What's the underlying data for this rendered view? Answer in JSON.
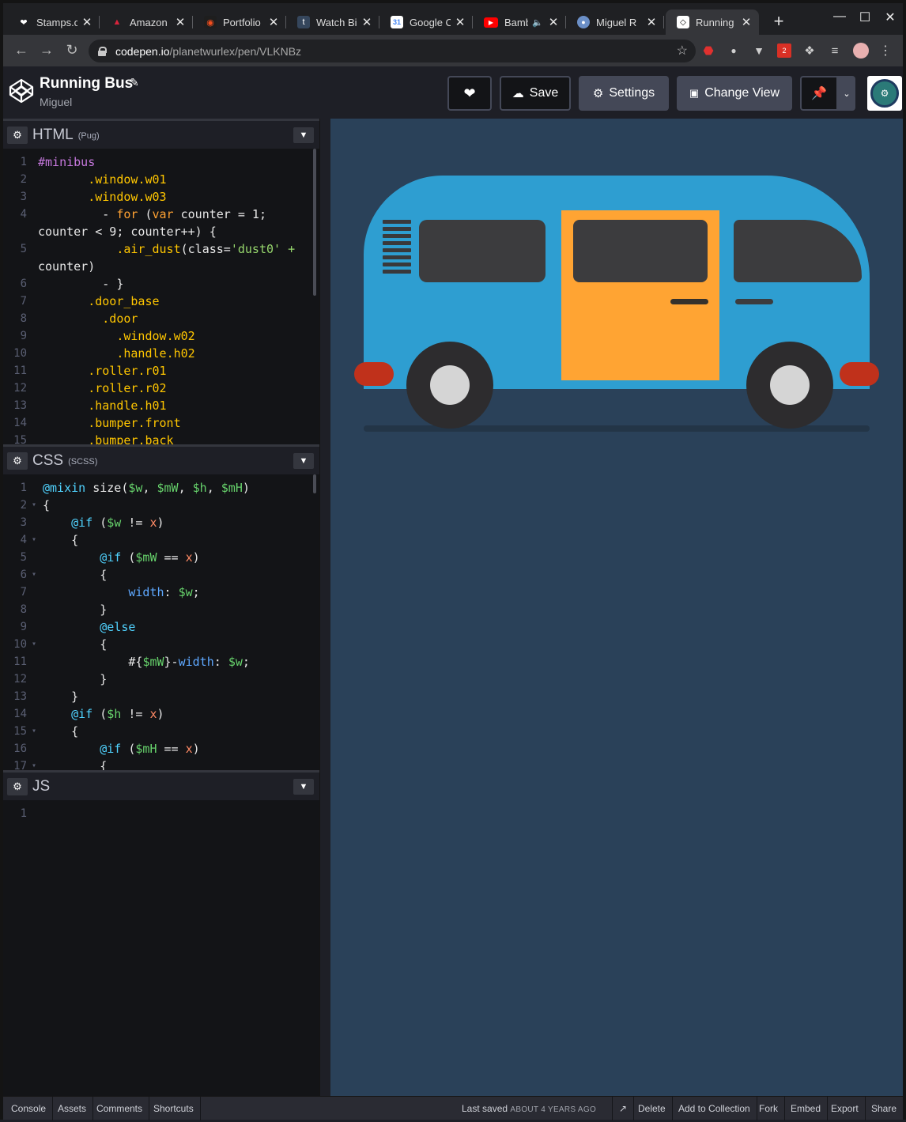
{
  "browser": {
    "tabs": [
      {
        "title": "Stamps.c",
        "icon": "heart-favicon",
        "color": "#ffffff"
      },
      {
        "title": "Amazon (",
        "icon": "bird-favicon",
        "color": "#d8243c"
      },
      {
        "title": "Portfolio",
        "icon": "figma-favicon",
        "color": "#f24e1e"
      },
      {
        "title": "Watch Bi",
        "icon": "tumblr-favicon",
        "color": "#35465c"
      },
      {
        "title": "Google C",
        "icon": "calendar-favicon",
        "color": "#4285f4"
      },
      {
        "title": "Bamb",
        "icon": "youtube-favicon",
        "color": "#ff0000"
      },
      {
        "title": "Miguel R",
        "icon": "avatar-favicon",
        "color": "#6b8fc7"
      },
      {
        "title": "Running",
        "icon": "codepen-favicon",
        "color": "#ffffff"
      }
    ],
    "url_host": "codepen.io",
    "url_path": "/planetwurlex/pen/VLKNBz",
    "extension_badge": "2"
  },
  "pen": {
    "title": "Running Bus",
    "author": "Miguel",
    "buttons": {
      "save": "Save",
      "settings": "Settings",
      "change_view": "Change View"
    }
  },
  "editors": {
    "html": {
      "name": "HTML",
      "preprocessor": "(Pug)",
      "lines": [
        {
          "n": "1",
          "t": "#minibus"
        },
        {
          "n": "2",
          "t": "       .window.w01"
        },
        {
          "n": "3",
          "t": "       .window.w03"
        },
        {
          "n": "4",
          "t": "         - for (var counter = 1;"
        },
        {
          "n": "",
          "t": "counter < 9; counter++) {"
        },
        {
          "n": "5",
          "t": "           .air_dust(class='dust0' +"
        },
        {
          "n": "",
          "t": "counter)"
        },
        {
          "n": "6",
          "t": "         - }"
        },
        {
          "n": "7",
          "t": "       .door_base"
        },
        {
          "n": "8",
          "t": "         .door"
        },
        {
          "n": "9",
          "t": "           .window.w02"
        },
        {
          "n": "10",
          "t": "           .handle.h02"
        },
        {
          "n": "11",
          "t": "       .roller.r01"
        },
        {
          "n": "12",
          "t": "       .roller.r02"
        },
        {
          "n": "13",
          "t": "       .handle.h01"
        },
        {
          "n": "14",
          "t": "       .bumper.front"
        },
        {
          "n": "15",
          "t": "       .bumper.back"
        }
      ]
    },
    "css": {
      "name": "CSS",
      "preprocessor": "(SCSS)",
      "lines": [
        {
          "n": "1",
          "t": "@mixin size($w, $mW, $h, $mH)"
        },
        {
          "n": "2",
          "t": "{"
        },
        {
          "n": "3",
          "t": "    @if ($w != x)"
        },
        {
          "n": "4",
          "t": "    {"
        },
        {
          "n": "5",
          "t": "        @if ($mW == x)"
        },
        {
          "n": "6",
          "t": "        {"
        },
        {
          "n": "7",
          "t": "            width: $w;"
        },
        {
          "n": "8",
          "t": "        }"
        },
        {
          "n": "9",
          "t": "        @else"
        },
        {
          "n": "10",
          "t": "        {"
        },
        {
          "n": "11",
          "t": "            #{$mW}-width: $w;"
        },
        {
          "n": "12",
          "t": "        }"
        },
        {
          "n": "13",
          "t": "    }"
        },
        {
          "n": "14",
          "t": "    @if ($h != x)"
        },
        {
          "n": "15",
          "t": "    {"
        },
        {
          "n": "16",
          "t": "        @if ($mH == x)"
        },
        {
          "n": "17",
          "t": "        {"
        }
      ]
    },
    "js": {
      "name": "JS",
      "lines": [
        {
          "n": "1",
          "t": ""
        }
      ]
    }
  },
  "footer": {
    "console": "Console",
    "assets": "Assets",
    "comments": "Comments",
    "shortcuts": "Shortcuts",
    "last_saved": "Last saved",
    "saved_ago": "ABOUT 4 YEARS AGO",
    "delete": "Delete",
    "add_to_collection": "Add to Collection",
    "fork": "Fork",
    "embed": "Embed",
    "export": "Export",
    "share": "Share"
  },
  "colors": {
    "preview_bg": "#2a4159",
    "bus_body": "#2e9ed1",
    "bus_door": "#ffa433",
    "bumper": "#c0311b",
    "editor_bg": "#131417"
  }
}
